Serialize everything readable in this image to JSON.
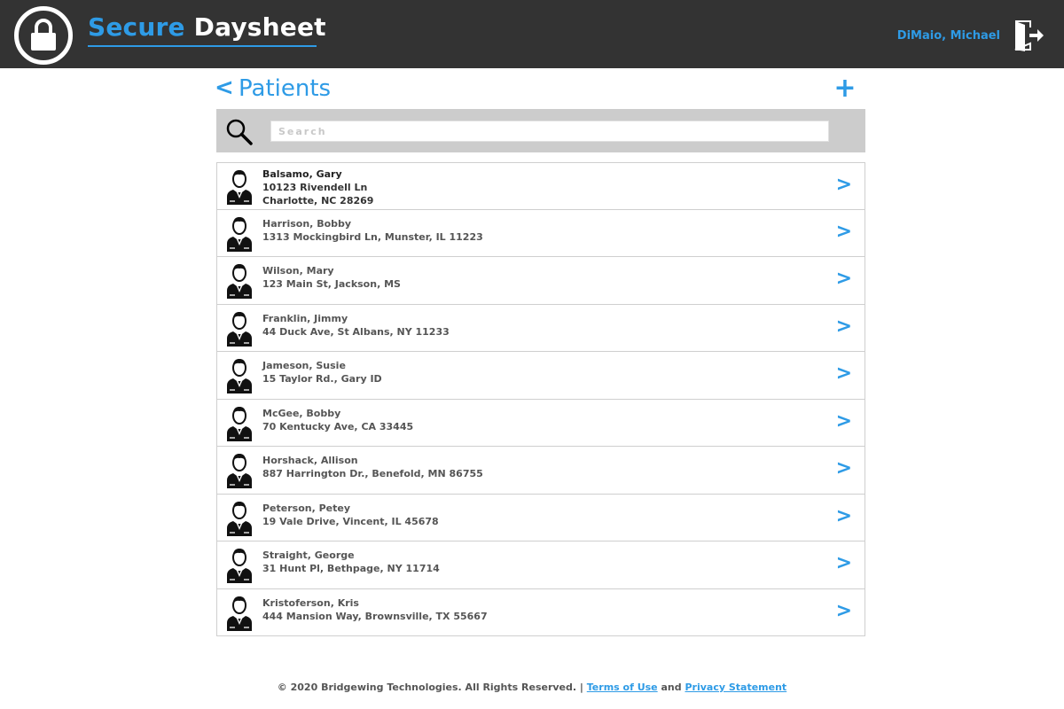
{
  "app": {
    "brand_part1": "Secure",
    "brand_part2": "Daysheet",
    "user_name": "DiMaio, Michael"
  },
  "page": {
    "back_label": "<",
    "title": "Patients",
    "add_label": "+"
  },
  "search": {
    "placeholder": "Search"
  },
  "patients": [
    {
      "name": "Balsamo, Gary",
      "address": "10123 Rivendell Ln",
      "city": "Charlotte, NC 28269"
    },
    {
      "name": "Harrison, Bobby",
      "address": "1313 Mockingbird Ln, Munster, IL 11223"
    },
    {
      "name": "Wilson, Mary",
      "address": "123 Main St, Jackson, MS"
    },
    {
      "name": "Franklin, Jimmy",
      "address": "44 Duck Ave, St Albans, NY 11233"
    },
    {
      "name": "Jameson, Susie",
      "address": "15 Taylor Rd., Gary ID"
    },
    {
      "name": "McGee, Bobby",
      "address": "70 Kentucky Ave, CA 33445"
    },
    {
      "name": "Horshack, Allison",
      "address": "887 Harrington Dr., Benefold, MN 86755"
    },
    {
      "name": "Peterson, Petey",
      "address": "19 Vale Drive, Vincent, IL 45678"
    },
    {
      "name": "Straight, George",
      "address": "31 Hunt Pl, Bethpage, NY 11714"
    },
    {
      "name": "Kristoferson, Kris",
      "address": "444 Mansion Way, Brownsville, TX 55667"
    }
  ],
  "row_chevron": ">",
  "footer": {
    "copyright": "© 2020 Bridgewing Technologies. All Rights Reserved. |",
    "terms": "Terms of Use",
    "and": "and",
    "privacy": "Privacy Statement"
  },
  "colors": {
    "accent": "#2e9be6",
    "header_bg": "#333333",
    "search_bg": "#cccccc"
  },
  "icons": {
    "logo": "padlock-icon",
    "logout": "logout-door-icon",
    "search": "magnifier-icon",
    "avatar": "person-avatar-icon"
  }
}
